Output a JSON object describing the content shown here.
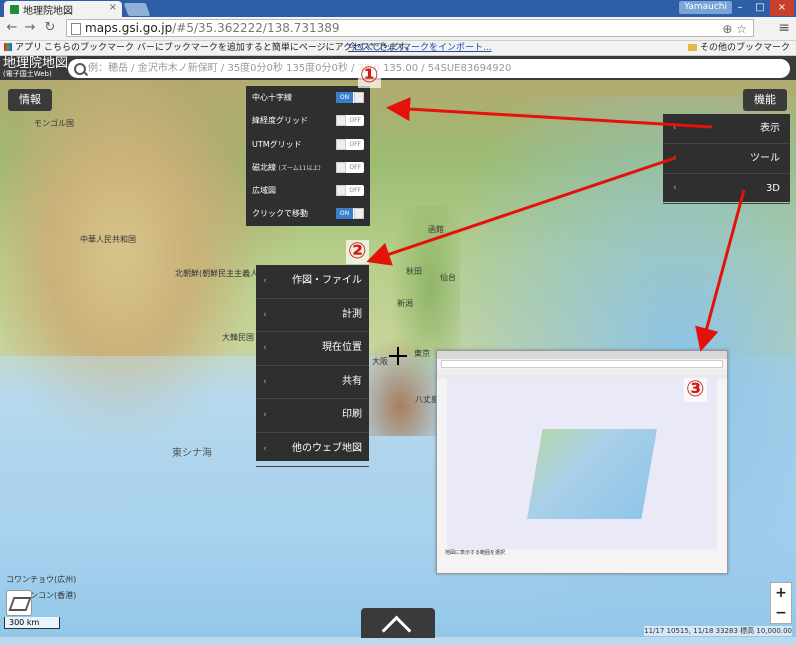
{
  "browser": {
    "tab_title": "地理院地図",
    "user": "Yamauchi",
    "url_host": "maps.gsi.go.jp",
    "url_path": "/#5/35.362222/138.731389",
    "apps_label": "アプリ",
    "bookmark_msg": "こちらのブックマーク バーにブックマークを追加すると簡単にページにアクセスできます。",
    "bookmark_import": "今すぐブックマークをインポート...",
    "other_bookmarks": "その他のブックマーク"
  },
  "header": {
    "logo_main": "地理院地図",
    "logo_sub": "(電子国土Web)",
    "search_placeholder": "例：穂岳 / 金沢市木ノ新保町 / 35度0分0秒 135度0分0秒 / 35.0 135.00 / 54SUE83694920"
  },
  "buttons": {
    "info": "情報",
    "functions": "機能"
  },
  "display_panel": [
    {
      "label": "中心十字線",
      "sub": "",
      "state": "ON"
    },
    {
      "label": "緯経度グリッド",
      "sub": "",
      "state": "OFF"
    },
    {
      "label": "UTMグリッド",
      "sub": "",
      "state": "OFF"
    },
    {
      "label": "磁北線",
      "sub": "(ズーム11以上)",
      "state": "OFF"
    },
    {
      "label": "広域図",
      "sub": "",
      "state": "OFF"
    },
    {
      "label": "クリックで移動",
      "sub": "",
      "state": "ON"
    }
  ],
  "func_menu": [
    {
      "label": "表示"
    },
    {
      "label": "ツール"
    },
    {
      "label": "3D"
    }
  ],
  "tool_menu": [
    {
      "label": "作図・ファイル"
    },
    {
      "label": "計測"
    },
    {
      "label": "現在位置"
    },
    {
      "label": "共有"
    },
    {
      "label": "印刷"
    },
    {
      "label": "他のウェブ地図"
    }
  ],
  "callouts": {
    "c1": "①",
    "c2": "②",
    "c3": "③"
  },
  "map_labels": [
    {
      "t": "モンゴル国"
    },
    {
      "t": "中華人民共和国"
    },
    {
      "t": "北朝鮮(朝鮮民主主義人民共和国)"
    },
    {
      "t": "大韓民国"
    },
    {
      "t": "東シナ海"
    },
    {
      "t": "新潟"
    },
    {
      "t": "秋田"
    },
    {
      "t": "仙台"
    },
    {
      "t": "東京"
    },
    {
      "t": "大阪"
    },
    {
      "t": "函館"
    },
    {
      "t": "八丈島"
    },
    {
      "t": "コワンチョウ(広州)"
    },
    {
      "t": "ホンコン(香港)"
    }
  ],
  "scale_text": "300 km",
  "coord_text": "11/17 10515, 11/18 33283 標高 10,000.00",
  "zoom": {
    "in": "+",
    "out": "−"
  },
  "inset_note": "地図に表示する範囲を選択",
  "colors": {
    "panel": "#2f2f2f",
    "accent_on": "#3b7ec9",
    "arrow": "#e3120b"
  }
}
